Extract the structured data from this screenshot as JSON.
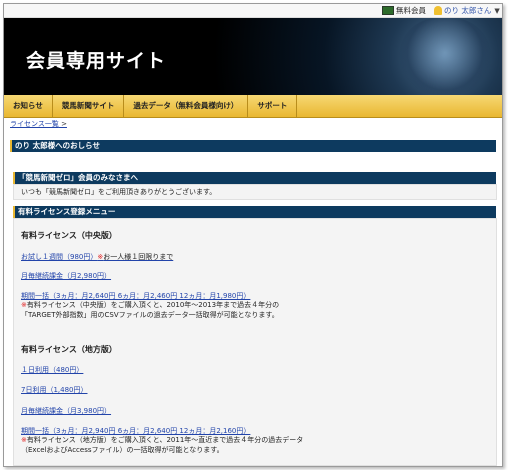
{
  "header": {
    "member_label": "無料会員",
    "user_label": "のり 太郎さん",
    "caret": "▼"
  },
  "site": {
    "title": "会員専用サイト"
  },
  "nav": {
    "items": [
      {
        "label": "お知らせ"
      },
      {
        "label": "競馬新聞サイト"
      },
      {
        "label": "過去データ（無料会員様向け）"
      },
      {
        "label": "サポート"
      }
    ]
  },
  "breadcrumb": {
    "link": "ライセンス一覧",
    "separator": " >"
  },
  "notice": {
    "title": "のり 太郎様へのおしらせ"
  },
  "welcome": {
    "title": "「競馬新聞ゼロ」会員のみなさまへ",
    "message": "いつも「競馬新聞ゼロ」をご利用頂きありがとうございます。"
  },
  "menu": {
    "title": "有料ライセンス登録メニュー"
  },
  "central": {
    "title": "有料ライセンス（中央版）",
    "trial": "お試し１週間（980円）",
    "trial_note_mark": "※",
    "trial_note": "お一人様１回限りまで",
    "monthly": "月毎継続課金（月2,980円）",
    "period": "期間一括（3ヵ月：月2,640円 6ヵ月：月2,460円 12ヵ月：月1,980円）",
    "note_mark": "※",
    "note_line1": "有料ライセンス（中央版）をご購入頂くと、2010年〜2013年まで過去４年分の",
    "note_line2": "「TARGET外部指数」用のCSVファイルの過去データ一括取得が可能となります。"
  },
  "local": {
    "title": "有料ライセンス（地方版）",
    "day1": "１日利用（480円）",
    "day7": "7日利用（1,480円）",
    "monthly": "月毎継続課金（月3,980円）",
    "period": "期間一括（3ヵ月：月2,940円 6ヵ月：月2,640円 12ヵ月：月2,160円）",
    "note_mark": "※",
    "note_line1": "有料ライセンス（地方版）をご購入頂くと、2011年〜直近まで過去４年分の過去データ",
    "note_line2": "（ExcelおよびAccessファイル）の一括取得が可能となります。"
  }
}
